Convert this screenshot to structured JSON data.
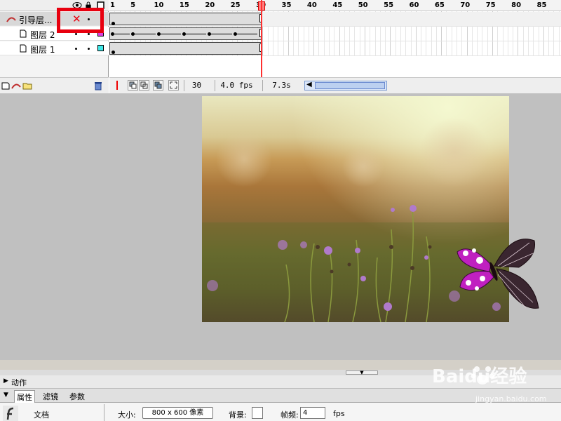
{
  "timeline": {
    "frame_numbers": [
      "1",
      "5",
      "10",
      "15",
      "20",
      "25",
      "30",
      "35",
      "40",
      "45",
      "50",
      "55",
      "60",
      "65",
      "70",
      "75",
      "80",
      "85"
    ],
    "layers": [
      {
        "name": "引导层...",
        "type": "guide",
        "color": ""
      },
      {
        "name": "图层 2",
        "type": "normal",
        "color": "#e040e0"
      },
      {
        "name": "图层 1",
        "type": "normal",
        "color": "#40e8e8"
      }
    ],
    "highlight_mark": "✕",
    "current_frame": "30",
    "fps": "4.0 fps",
    "elapsed": "7.3s"
  },
  "bottom": {
    "actions_label": "动作",
    "tabs": [
      "属性",
      "滤镜",
      "参数"
    ],
    "doc_label": "文档",
    "size_label": "大小:",
    "size_value": "800 x 600 像素",
    "bg_label": "背景:",
    "fps_label": "帧频:",
    "fps_value": "4",
    "fps_unit": "fps"
  },
  "watermark": {
    "brand": "Baidu经验",
    "url": "jingyan.baidu.com"
  },
  "colors": {
    "highlight": "#e8000f",
    "playhead": "#ff3030",
    "layer2": "#e040e0",
    "layer1": "#40e8e8"
  }
}
